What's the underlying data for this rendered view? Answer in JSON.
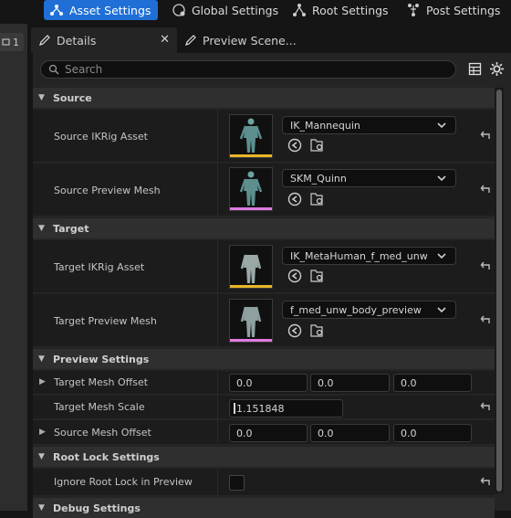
{
  "toolbar": {
    "asset_settings": "Asset Settings",
    "global_settings": "Global Settings",
    "root_settings": "Root Settings",
    "post_settings": "Post Settings"
  },
  "left_tab": {
    "count": "1"
  },
  "tabs": {
    "details": "Details",
    "preview": "Preview Scene..."
  },
  "search": {
    "placeholder": "Search"
  },
  "sections": {
    "source": "Source",
    "target": "Target",
    "preview_settings": "Preview Settings",
    "root_lock": "Root Lock Settings",
    "debug": "Debug Settings"
  },
  "source": {
    "ikrig_label": "Source IKRig Asset",
    "ikrig_value": "IK_Mannequin",
    "mesh_label": "Source Preview Mesh",
    "mesh_value": "SKM_Quinn"
  },
  "target": {
    "ikrig_label": "Target IKRig Asset",
    "ikrig_value": "IK_MetaHuman_f_med_unw",
    "mesh_label": "Target Preview Mesh",
    "mesh_value": "f_med_unw_body_preview"
  },
  "preview": {
    "target_offset_label": "Target Mesh Offset",
    "target_offset": [
      "0.0",
      "0.0",
      "0.0"
    ],
    "scale_label": "Target Mesh Scale",
    "scale_value": "1.151848",
    "source_offset_label": "Source Mesh Offset",
    "source_offset": [
      "0.0",
      "0.0",
      "0.0"
    ]
  },
  "root_lock": {
    "ignore_label": "Ignore Root Lock in Preview"
  },
  "colors": {
    "accent": "#1f6fd6",
    "ikrig_bar": "#e8b62a",
    "mesh_bar": "#e07ae0"
  }
}
